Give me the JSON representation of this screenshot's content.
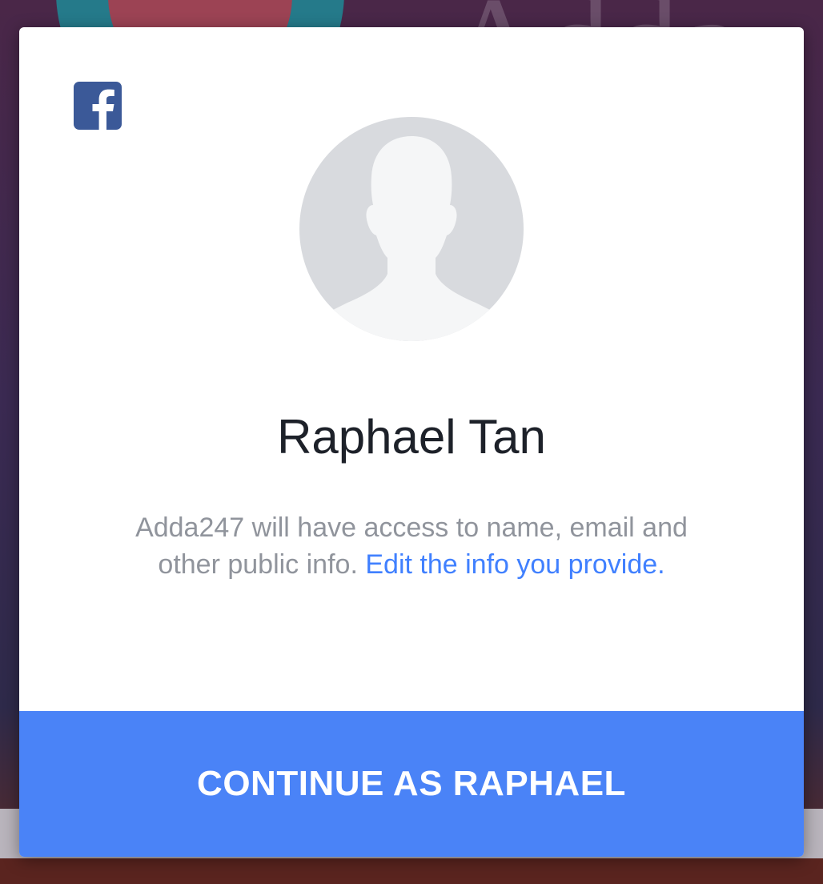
{
  "background": {
    "app_name_fragment": "Adda",
    "colors": {
      "teal": "#1e8a96",
      "red": "#b23a4a",
      "purple": "#3b2a52"
    }
  },
  "dialog": {
    "logo_icon": "facebook-icon",
    "avatar_icon": "default-profile-silhouette-icon",
    "user_name": "Raphael Tan",
    "info_text": "Adda247 will have access to name, email and other public info.",
    "edit_link": "Edit the info you provide.",
    "continue_label": "CONTINUE AS RAPHAEL",
    "colors": {
      "facebook_blue": "#3b5998",
      "link_blue": "#4080ff",
      "button_blue": "#4a83f7",
      "avatar_gray": "#d8dade",
      "silhouette_white": "#f5f6f7"
    }
  }
}
